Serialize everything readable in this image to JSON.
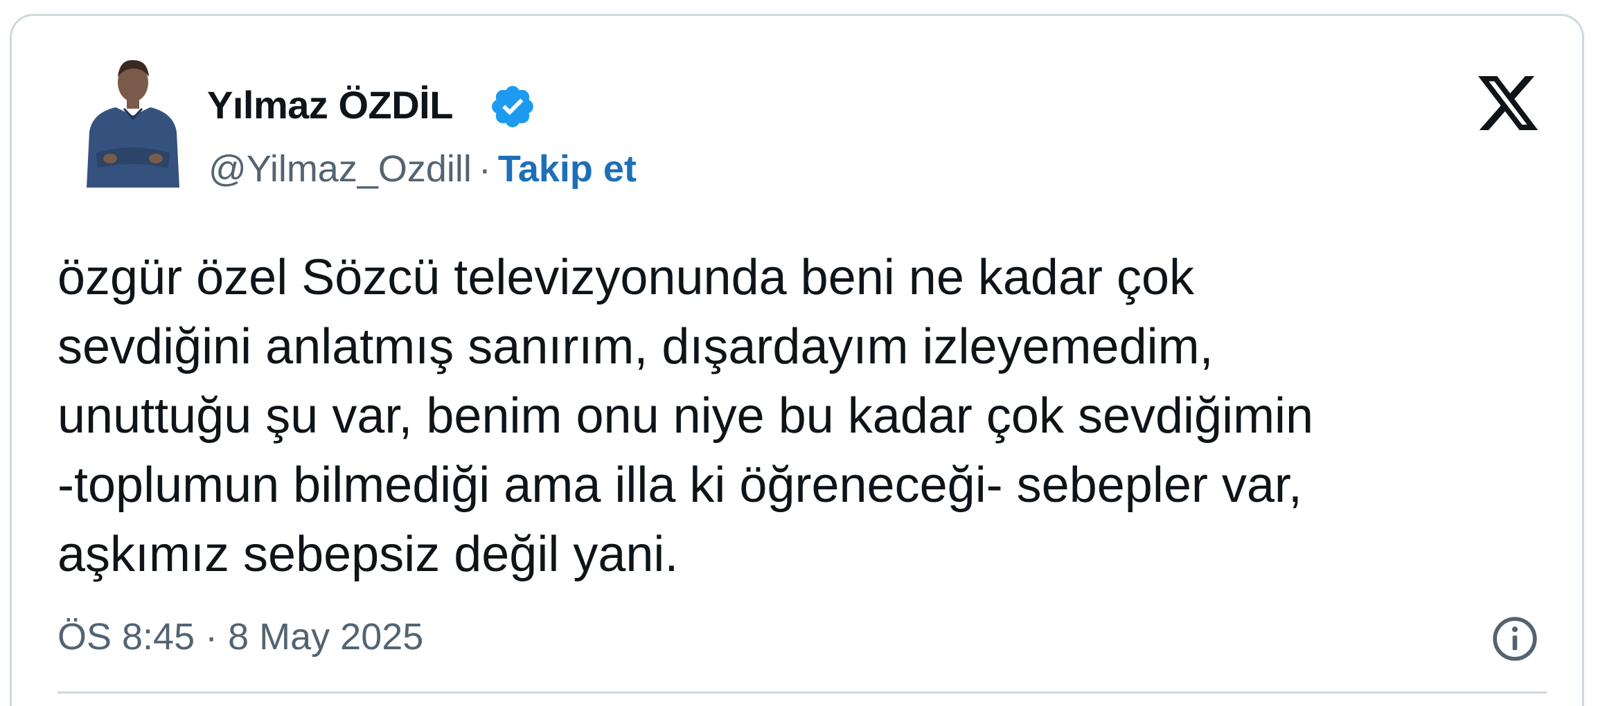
{
  "author": {
    "name": "Yılmaz ÖZDİL",
    "handle": "@Yilmaz_Ozdill",
    "separator": "·",
    "follow_label": "Takip et",
    "verified": true,
    "avatar_icon": "person-avatar-icon"
  },
  "brand": {
    "logo_icon": "x-logo-icon"
  },
  "tweet": {
    "lines": [
      "özgür özel Sözcü televizyonunda beni ne kadar çok",
      "sevdiğini anlatmış sanırım, dışardayım izleyemedim,",
      "unuttuğu şu var, benim onu niye bu kadar çok sevdiğimin",
      "-toplumun bilmediği ama illa ki öğreneceği- sebepler var,",
      "aşkımız sebepsiz değil yani."
    ],
    "timestamp": "ÖS 8:45 · 8 May 2025"
  },
  "icons": {
    "verified": "verified-badge-icon",
    "info": "info-icon"
  },
  "colors": {
    "text": "#0f1419",
    "secondary": "#536471",
    "link": "#1d6fb8",
    "verified": "#1d9bf0",
    "border": "#cfd9de"
  }
}
